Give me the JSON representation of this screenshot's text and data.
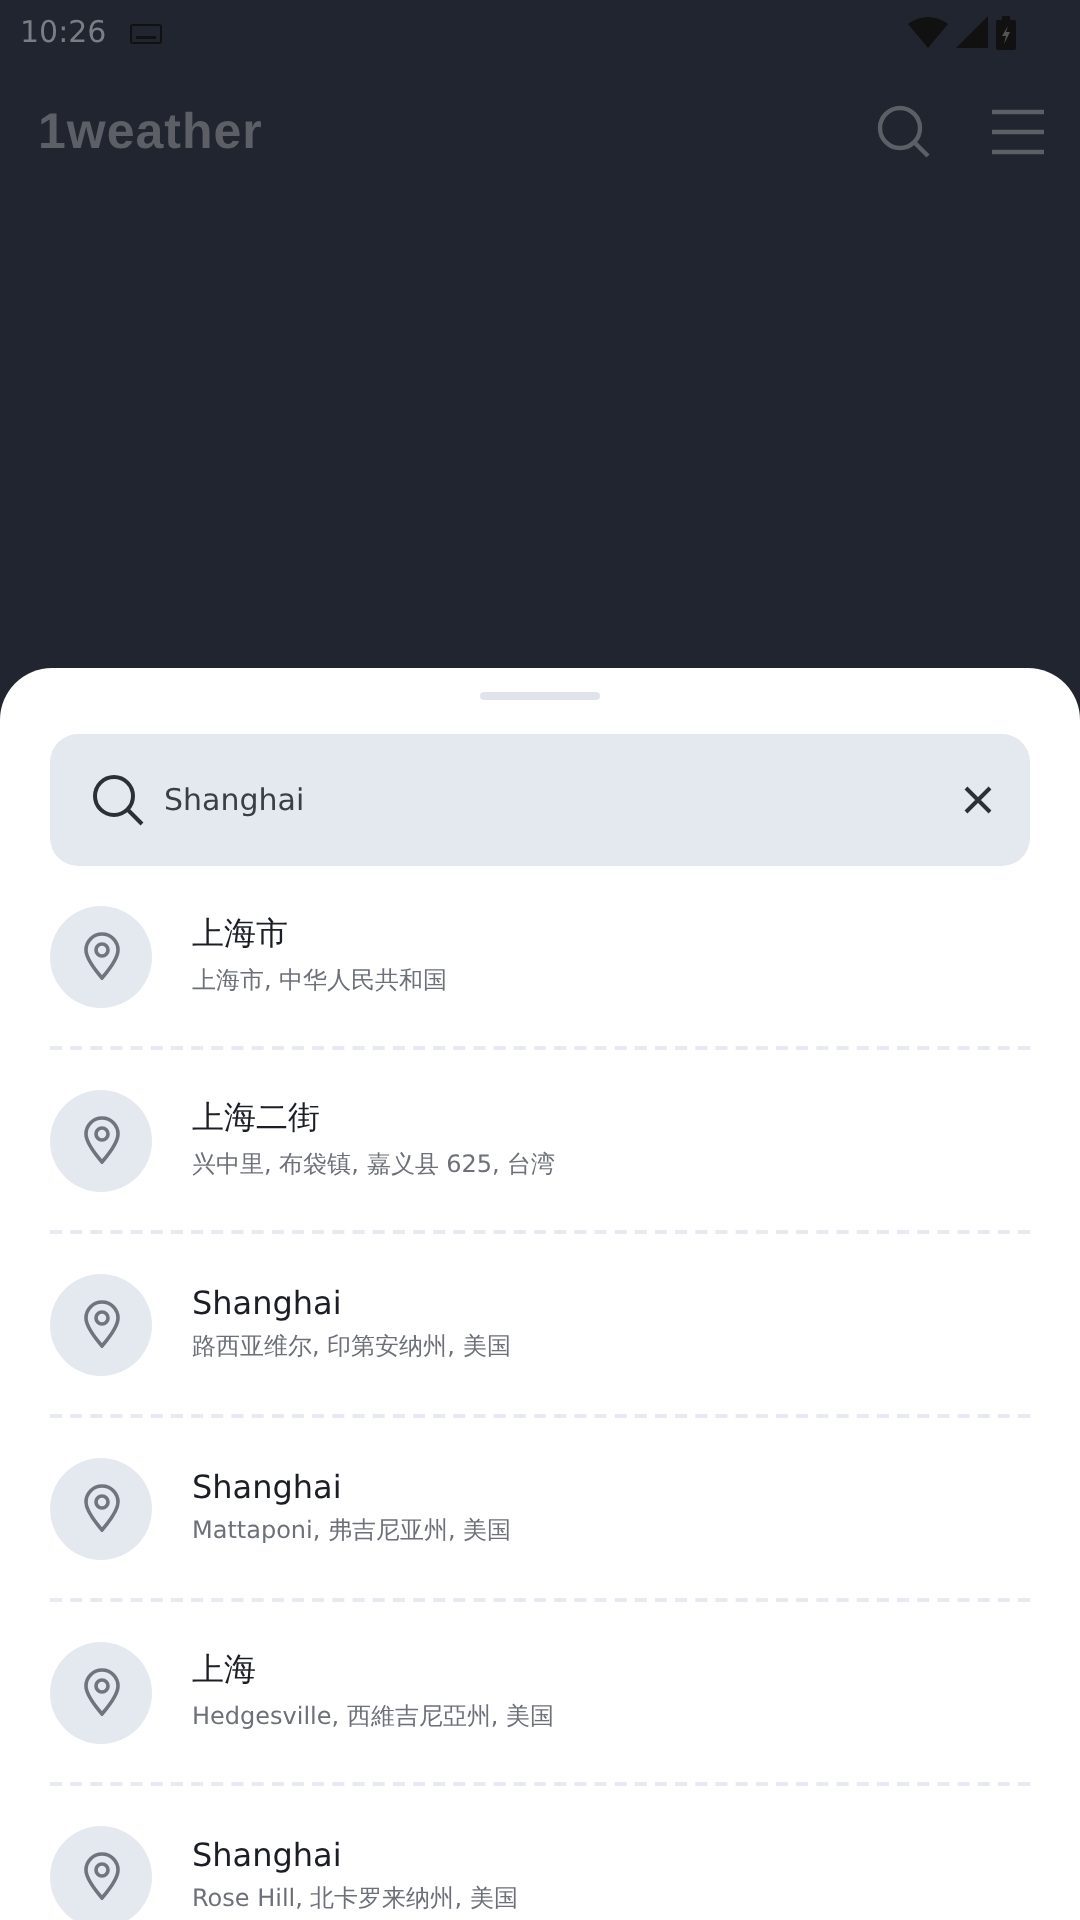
{
  "status_bar": {
    "time": "10:26"
  },
  "header": {
    "logo": "1weather"
  },
  "search": {
    "value": "Shanghai"
  },
  "results": [
    {
      "name": "上海市",
      "detail": "上海市, 中华人民共和国"
    },
    {
      "name": "上海二街",
      "detail": "兴中里, 布袋镇, 嘉义县 625, 台湾"
    },
    {
      "name": "Shanghai",
      "detail": "路西亚维尔, 印第安纳州, 美国"
    },
    {
      "name": "Shanghai",
      "detail": "Mattaponi, 弗吉尼亚州, 美国"
    },
    {
      "name": "上海",
      "detail": "Hedgesville, 西維吉尼亞州, 美国"
    },
    {
      "name": "Shanghai",
      "detail": "Rose Hill, 北卡罗来纳州, 美国"
    }
  ]
}
